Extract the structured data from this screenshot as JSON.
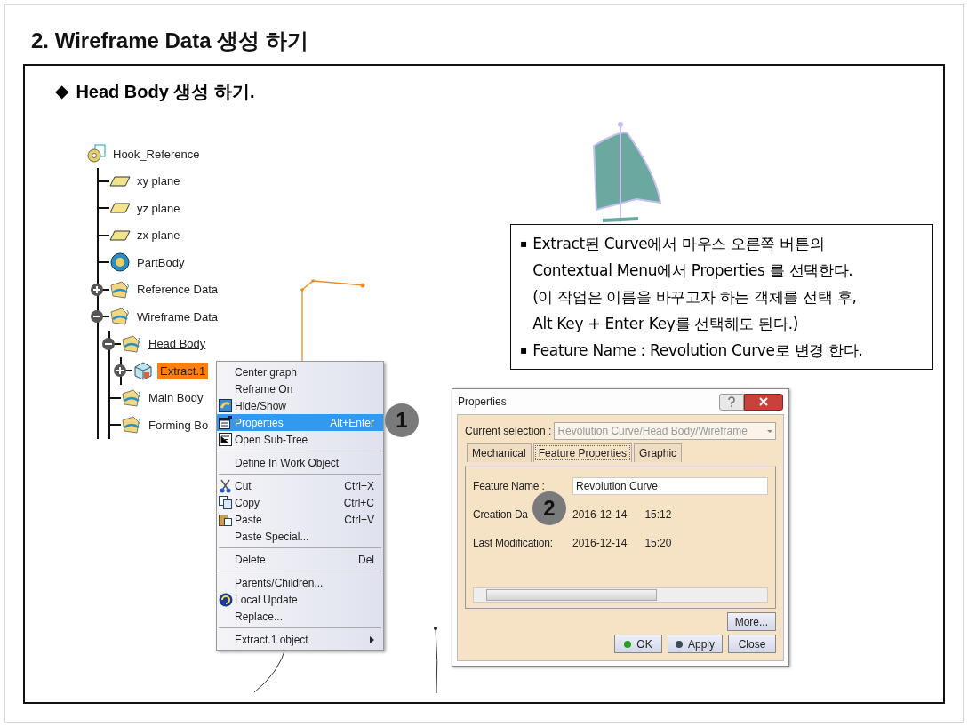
{
  "title": "2. Wireframe Data 생성 하기",
  "subtitle": {
    "marker": "◆",
    "text": "Head Body 생성 하기."
  },
  "tree": {
    "kind": "root",
    "label": "Hook_Reference",
    "selected": false,
    "in_work": false,
    "children": [
      {
        "kind": "plane",
        "label": "xy plane",
        "selected": false,
        "in_work": false
      },
      {
        "kind": "plane",
        "label": "yz plane",
        "selected": false,
        "in_work": false
      },
      {
        "kind": "plane",
        "label": "zx plane",
        "selected": false,
        "in_work": false
      },
      {
        "kind": "body",
        "label": "PartBody",
        "selected": false,
        "in_work": false
      },
      {
        "kind": "geoset",
        "label": "Reference Data",
        "expanded": false,
        "selected": false,
        "in_work": false
      },
      {
        "kind": "geoset",
        "label": "Wireframe Data",
        "expanded": true,
        "selected": false,
        "in_work": false,
        "children": [
          {
            "kind": "geoset",
            "label": "Head Body",
            "expanded": true,
            "selected": false,
            "in_work": true,
            "children": [
              {
                "kind": "extract",
                "label": "Extract.1",
                "expanded": false,
                "selected": true,
                "in_work": false
              }
            ]
          },
          {
            "kind": "geoset",
            "label": "Main Body",
            "selected": false,
            "in_work": false
          },
          {
            "kind": "geoset",
            "label": "Forming Bo",
            "selected": false,
            "in_work": false
          }
        ]
      }
    ]
  },
  "menu": [
    {
      "kind": "item",
      "label": "Center graph",
      "selected": false
    },
    {
      "kind": "item",
      "label": "Reframe On",
      "selected": false
    },
    {
      "kind": "item",
      "label": "Hide/Show",
      "selected": false
    },
    {
      "kind": "item",
      "label": "Properties",
      "shortcut": "Alt+Enter",
      "selected": true
    },
    {
      "kind": "item",
      "label": "Open Sub-Tree",
      "selected": false
    },
    {
      "kind": "separator"
    },
    {
      "kind": "item",
      "label": "Define In Work Object",
      "selected": false
    },
    {
      "kind": "separator"
    },
    {
      "kind": "item",
      "label": "Cut",
      "shortcut": "Ctrl+X",
      "selected": false
    },
    {
      "kind": "item",
      "label": "Copy",
      "shortcut": "Ctrl+C",
      "selected": false
    },
    {
      "kind": "item",
      "label": "Paste",
      "shortcut": "Ctrl+V",
      "selected": false
    },
    {
      "kind": "item",
      "label": "Paste Special...",
      "selected": false
    },
    {
      "kind": "separator"
    },
    {
      "kind": "item",
      "label": "Delete",
      "shortcut": "Del",
      "selected": false
    },
    {
      "kind": "separator"
    },
    {
      "kind": "item",
      "label": "Parents/Children...",
      "selected": false
    },
    {
      "kind": "item",
      "label": "Local Update",
      "selected": false
    },
    {
      "kind": "item",
      "label": "Replace...",
      "selected": false
    },
    {
      "kind": "separator"
    },
    {
      "kind": "item",
      "label": "Extract.1 object",
      "submenu": true,
      "selected": false
    }
  ],
  "notes": [
    {
      "marker": "▪",
      "lines": [
        "Extract된 Curve에서 마우스 오른쪽 버튼의",
        "Contextual Menu에서 Properties 를 선택한다.",
        "(이 작업은 이름을 바꾸고자 하는 객체를 선택 후,",
        "Alt Key + Enter Key를 선택해도 된다.)"
      ]
    },
    {
      "marker": "▪",
      "lines": [
        "Feature Name : Revolution Curve로 변경 한다."
      ]
    }
  ],
  "dialog": {
    "title": "Properties",
    "selection_label": "Current selection :",
    "selection_value": "Revolution Curve/Head Body/Wireframe",
    "selection_disabled": true,
    "tabs": [
      {
        "label": "Mechanical",
        "selected": false
      },
      {
        "label": "Feature Properties",
        "selected": true
      },
      {
        "label": "Graphic",
        "selected": false
      }
    ],
    "fields": [
      {
        "kind": "input",
        "label": "Feature Name :",
        "value": "Revolution Curve"
      },
      {
        "kind": "stamp",
        "label": "Creation Da",
        "date": "2016-12-14",
        "time": "15:12"
      },
      {
        "kind": "stamp",
        "label": "Last Modification:",
        "date": "2016-12-14",
        "time": "15:20"
      }
    ],
    "more_button": "More...",
    "buttons": [
      {
        "label": "OK",
        "color": "#22a022"
      },
      {
        "label": "Apply",
        "color": "#3a4a5a"
      },
      {
        "label": "Close"
      }
    ]
  },
  "badges": [
    "1",
    "2"
  ]
}
